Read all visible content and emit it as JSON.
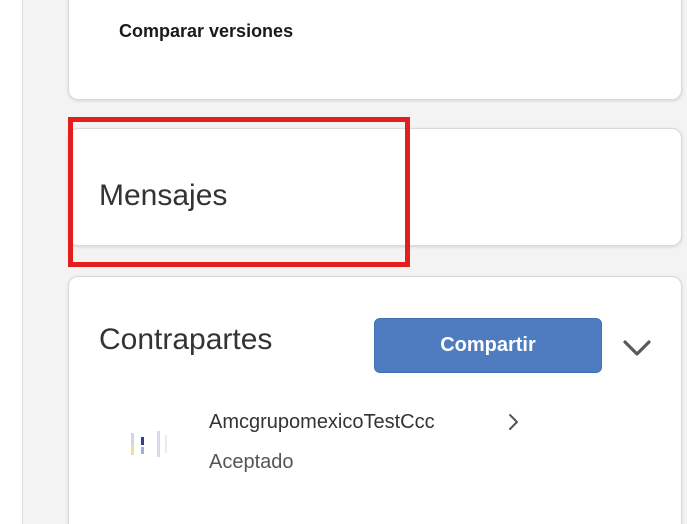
{
  "compare_versions": {
    "label": "Comparar versiones"
  },
  "messages_card": {
    "title": "Mensajes"
  },
  "counterparts_card": {
    "title": "Contrapartes",
    "share_label": "Compartir",
    "expand_icon": "chevron-down-icon",
    "parties": [
      {
        "name": "AmcgrupomexicoTestCcc",
        "status": "Aceptado",
        "logo_icon": "company-logo",
        "open_icon": "chevron-right-icon"
      }
    ]
  },
  "colors": {
    "highlight": "#e41e1e",
    "share_button": "#4f7cc0",
    "card_background": "#ffffff",
    "page_background": "#f3f3f3"
  }
}
